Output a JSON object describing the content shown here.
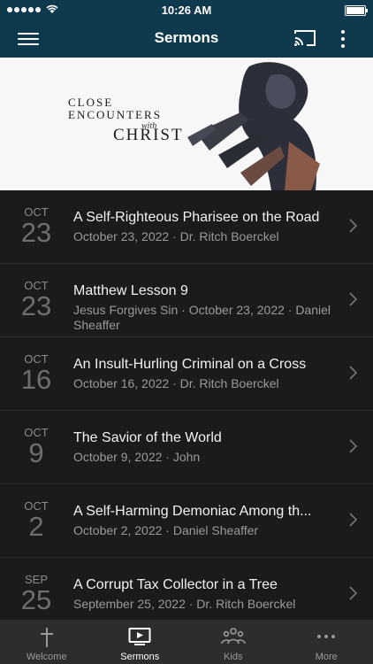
{
  "status_bar": {
    "time": "10:26 AM"
  },
  "header": {
    "title": "Sermons"
  },
  "banner": {
    "line1": "CLOSE",
    "line2": "ENCOUNTERS",
    "with": "with",
    "line3": "CHRIST"
  },
  "sermons": [
    {
      "month": "OCT",
      "day": "23",
      "title": "A Self-Righteous Pharisee on the Road",
      "subtitle": "October 23, 2022 · Dr. Ritch Boerckel"
    },
    {
      "month": "OCT",
      "day": "23",
      "title": "Matthew Lesson 9",
      "subtitle": "Jesus Forgives Sin · October 23, 2022 · Daniel Sheaffer"
    },
    {
      "month": "OCT",
      "day": "16",
      "title": "An Insult-Hurling Criminal on a Cross",
      "subtitle": "October 16, 2022 · Dr. Ritch Boerckel"
    },
    {
      "month": "OCT",
      "day": "9",
      "title": "The Savior of the World",
      "subtitle": "October 9, 2022 · John"
    },
    {
      "month": "OCT",
      "day": "2",
      "title": "A Self-Harming Demoniac  Among th...",
      "subtitle": "October 2, 2022 · Daniel Sheaffer"
    },
    {
      "month": "SEP",
      "day": "25",
      "title": "A Corrupt Tax Collector in a Tree",
      "subtitle": "September 25, 2022 · Dr. Ritch Boerckel"
    }
  ],
  "tabs": [
    {
      "label": "Welcome",
      "icon": "cross-icon"
    },
    {
      "label": "Sermons",
      "icon": "tv-play-icon"
    },
    {
      "label": "Kids",
      "icon": "people-icon"
    },
    {
      "label": "More",
      "icon": "dots-icon"
    }
  ],
  "colors": {
    "nav": "#0f3a4e",
    "list_bg": "#1b1b1b",
    "tabbar": "#2d2d2d"
  }
}
